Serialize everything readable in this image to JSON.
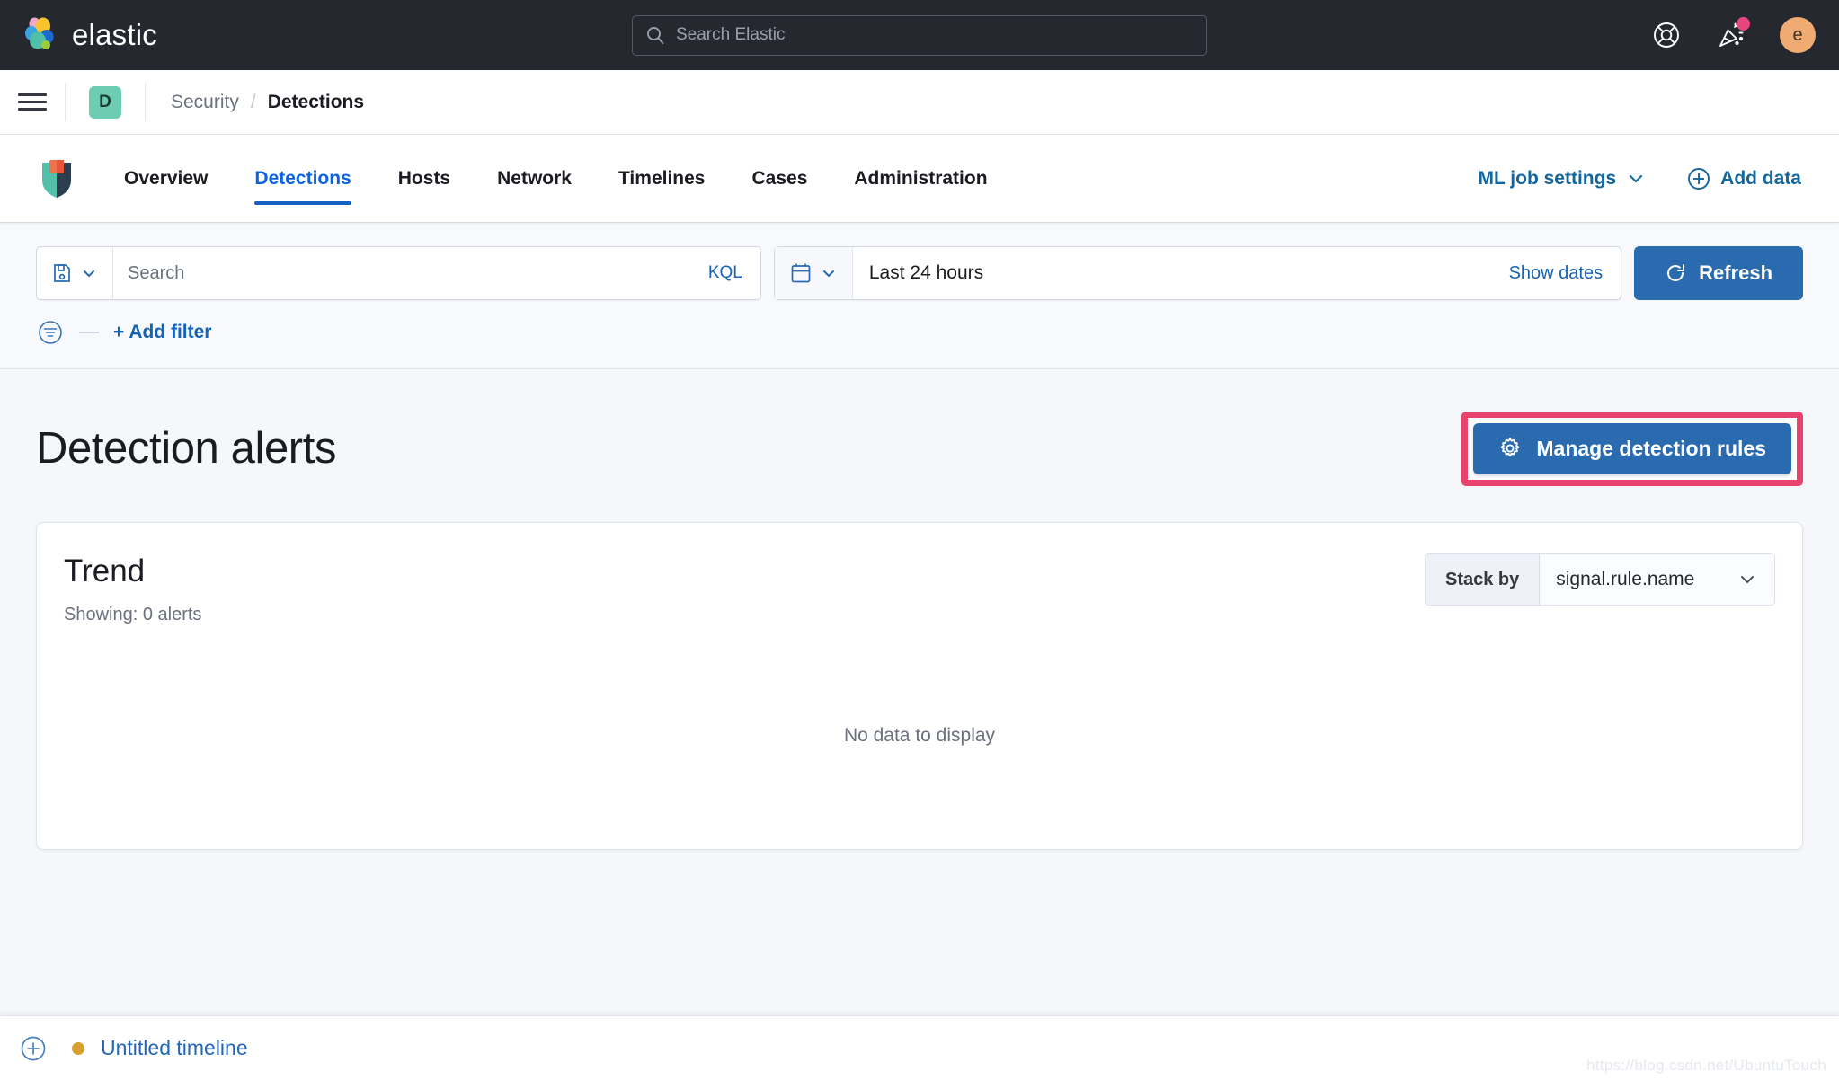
{
  "header": {
    "brand": "elastic",
    "search_placeholder": "Search Elastic",
    "help_icon": "lifebuoy-icon",
    "news_icon": "party-popper-icon",
    "avatar_initial": "e"
  },
  "breadcrumb": {
    "menu_icon": "hamburger-menu-icon",
    "space_initial": "D",
    "parent": "Security",
    "separator": "/",
    "current": "Detections"
  },
  "security_nav": {
    "logo_icon": "security-shield-icon",
    "tabs": [
      {
        "label": "Overview",
        "active": false
      },
      {
        "label": "Detections",
        "active": true
      },
      {
        "label": "Hosts",
        "active": false
      },
      {
        "label": "Network",
        "active": false
      },
      {
        "label": "Timelines",
        "active": false
      },
      {
        "label": "Cases",
        "active": false
      },
      {
        "label": "Administration",
        "active": false
      }
    ],
    "ml_job_settings": "ML job settings",
    "add_data": "Add data"
  },
  "query_bar": {
    "saved_query_icon": "save-disk-icon",
    "search_placeholder": "Search",
    "search_value": "",
    "language_badge": "KQL",
    "date_icon": "calendar-icon",
    "date_range": "Last 24 hours",
    "show_dates": "Show dates",
    "refresh": "Refresh",
    "refresh_icon": "refresh-icon",
    "filter_icon": "filter-circle-icon",
    "add_filter": "+ Add filter"
  },
  "main": {
    "page_title": "Detection alerts",
    "manage_rules_button": "Manage detection rules",
    "manage_rules_icon": "gear-icon",
    "highlight_color": "#e8436f"
  },
  "trend_panel": {
    "title": "Trend",
    "showing": "Showing: 0 alerts",
    "stack_by_label": "Stack by",
    "stack_by_value": "signal.rule.name",
    "chevron_icon": "chevron-down-icon",
    "empty_message": "No data to display"
  },
  "timeline_bar": {
    "add_icon": "plus-circle-icon",
    "status_dot_color": "#d6a12c",
    "timeline_name": "Untitled timeline"
  },
  "watermark": "https://blog.csdn.net/UbuntuTouch",
  "chart_data": {
    "type": "bar",
    "title": "Trend",
    "categories": [],
    "values": [],
    "series": [],
    "stack_by": "signal.rule.name",
    "time_range": "Last 24 hours",
    "total_alerts": 0,
    "empty_state": "No data to display",
    "xlabel": "",
    "ylabel": "",
    "grid": false,
    "legend": "none"
  }
}
